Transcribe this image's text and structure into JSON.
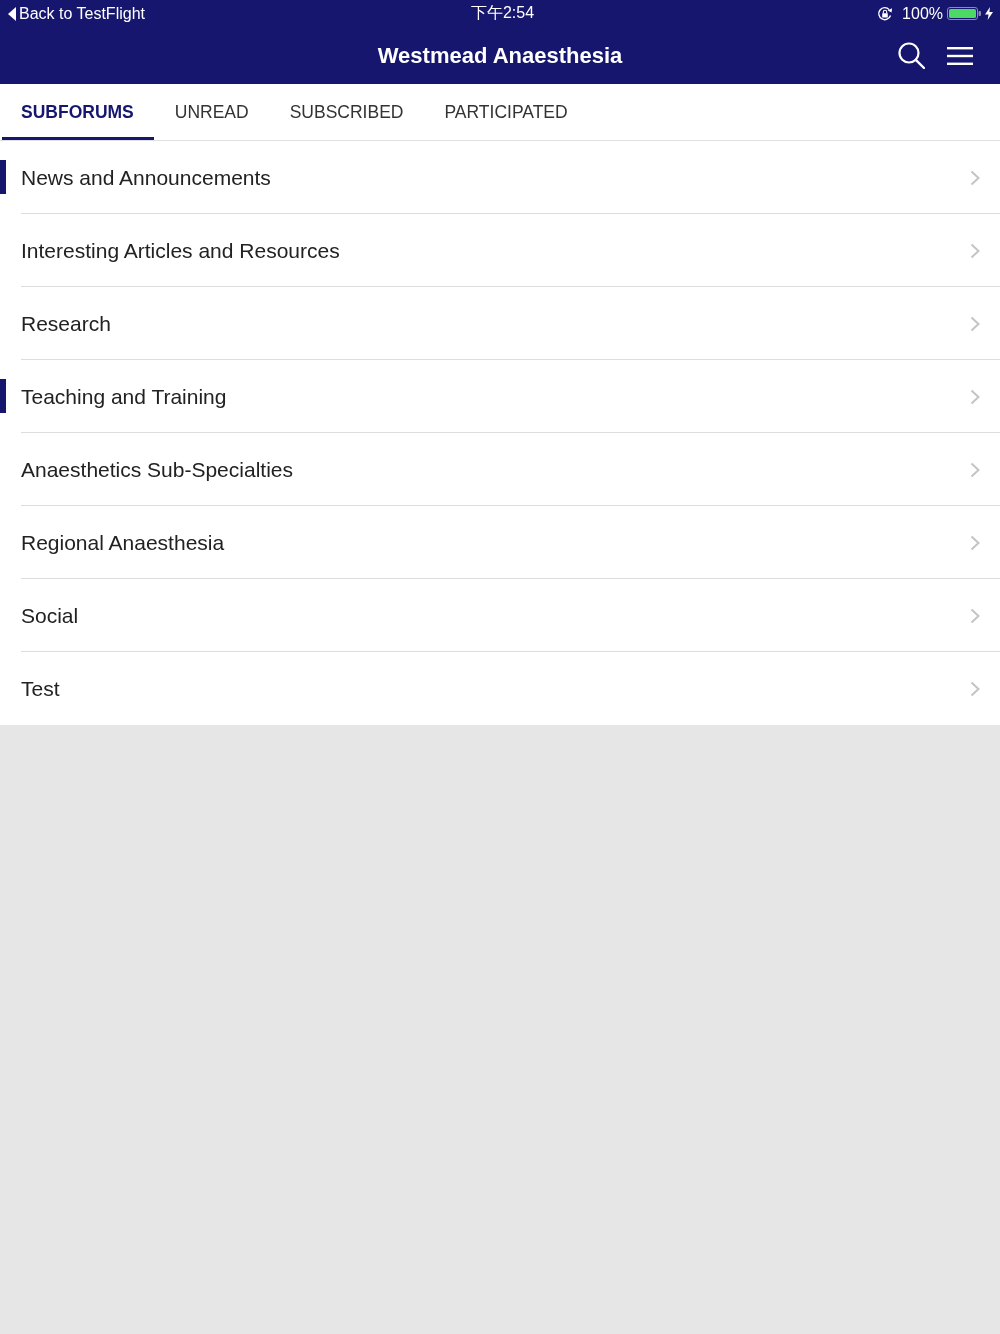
{
  "status_bar": {
    "back_link": "Back to TestFlight",
    "time": "下午2:54",
    "battery_percent": "100%"
  },
  "nav_bar": {
    "title": "Westmead Anaesthesia"
  },
  "tabs": [
    {
      "label": "SUBFORUMS",
      "selected": true
    },
    {
      "label": "UNREAD",
      "selected": false
    },
    {
      "label": "SUBSCRIBED",
      "selected": false
    },
    {
      "label": "PARTICIPATED",
      "selected": false
    }
  ],
  "subforums": [
    {
      "name": "News and Announcements",
      "unread": true
    },
    {
      "name": "Interesting Articles and Resources",
      "unread": false
    },
    {
      "name": "Research",
      "unread": false
    },
    {
      "name": "Teaching and Training",
      "unread": true
    },
    {
      "name": "Anaesthetics Sub-Specialties",
      "unread": false
    },
    {
      "name": "Regional Anaesthesia",
      "unread": false
    },
    {
      "name": "Social",
      "unread": false
    },
    {
      "name": "Test",
      "unread": false
    }
  ]
}
